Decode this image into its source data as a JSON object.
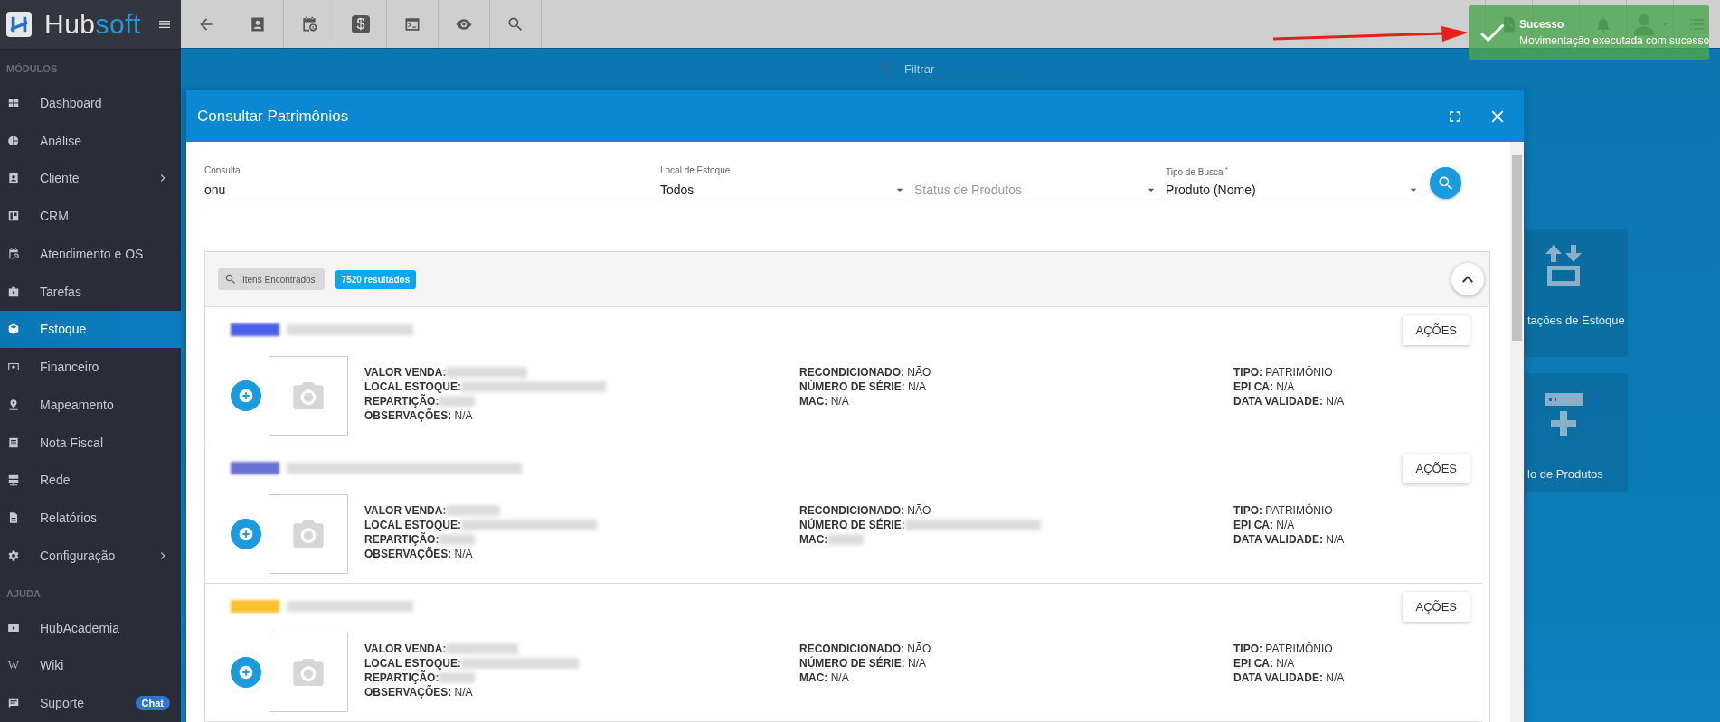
{
  "logo": {
    "part1": "Hub",
    "part2": "soft"
  },
  "sidebar": {
    "sections": [
      {
        "title": "MÓDULOS",
        "items": [
          {
            "label": "Dashboard",
            "selected": false,
            "submenu": false
          },
          {
            "label": "Análise",
            "selected": false,
            "submenu": false
          },
          {
            "label": "Cliente",
            "selected": false,
            "submenu": true
          },
          {
            "label": "CRM",
            "selected": false,
            "submenu": false
          },
          {
            "label": "Atendimento e OS",
            "selected": false,
            "submenu": false
          },
          {
            "label": "Tarefas",
            "selected": false,
            "submenu": false
          },
          {
            "label": "Estoque",
            "selected": true,
            "submenu": false
          },
          {
            "label": "Financeiro",
            "selected": false,
            "submenu": false
          },
          {
            "label": "Mapeamento",
            "selected": false,
            "submenu": false
          },
          {
            "label": "Nota Fiscal",
            "selected": false,
            "submenu": false
          },
          {
            "label": "Rede",
            "selected": false,
            "submenu": false
          },
          {
            "label": "Relatórios",
            "selected": false,
            "submenu": false
          },
          {
            "label": "Configuração",
            "selected": false,
            "submenu": true
          }
        ]
      },
      {
        "title": "AJUDA",
        "items": [
          {
            "label": "HubAcademia",
            "selected": false,
            "submenu": false
          },
          {
            "label": "Wiki",
            "selected": false,
            "submenu": false,
            "glyph": "W"
          },
          {
            "label": "Suporte",
            "selected": false,
            "submenu": false,
            "badge": "Chat"
          }
        ]
      }
    ]
  },
  "toolbar": {
    "buttons": [
      {
        "kind": "back"
      },
      {
        "kind": "contact"
      },
      {
        "kind": "calendar"
      },
      {
        "kind": "money",
        "glyph": "$"
      },
      {
        "kind": "terminal"
      },
      {
        "kind": "view"
      },
      {
        "kind": "search"
      }
    ]
  },
  "top_right": {
    "buttons": [
      {
        "kind": "pdf"
      },
      {
        "kind": "check"
      },
      {
        "kind": "bell"
      },
      {
        "kind": "avatar"
      },
      {
        "kind": "menu"
      }
    ]
  },
  "toast": {
    "title": "Sucesso",
    "message": "Movimentação executada com sucesso"
  },
  "filter": {
    "placeholder": "Filtrar"
  },
  "background_cards": [
    {
      "kind": "movement",
      "label": "tações de Estoque"
    },
    {
      "kind": "catalog",
      "label": "lo de Produtos"
    }
  ],
  "dialog": {
    "title": "Consultar Patrimônios",
    "form": {
      "fields": [
        {
          "kind": "text",
          "label": "Consulta",
          "value": "onu"
        },
        {
          "kind": "select",
          "label": "Local de Estoque",
          "value": "Todos"
        },
        {
          "kind": "select",
          "placeholder": "Status de Produtos"
        },
        {
          "kind": "select",
          "label": "Tipo de Busca",
          "required_mark": "*",
          "value": "Produto (Nome)"
        }
      ]
    },
    "results": {
      "chip": "Itens Encontrados",
      "count": "7520 resultados",
      "expanded": true,
      "items": [
        {
          "color": "#4c5fe6",
          "action": "AÇÕES",
          "columns": [
            [
              {
                "label": "VALOR VENDA:",
                "kind": "blurred"
              },
              {
                "label": "LOCAL ESTOQUE:",
                "kind": "blurred"
              },
              {
                "label": "REPARTIÇÃO:",
                "kind": "blurred"
              },
              {
                "label": "OBSERVAÇÕES:",
                "kind": "text",
                "value": "N/A"
              }
            ],
            [
              {
                "label": "RECONDICIONADO:",
                "kind": "text",
                "value": "NÃO"
              },
              {
                "label": "NÚMERO DE SÉRIE:",
                "kind": "text",
                "value": "N/A"
              },
              {
                "label": "MAC:",
                "kind": "text",
                "value": "N/A"
              }
            ],
            [
              {
                "label": "TIPO:",
                "kind": "text",
                "value": "PATRIMÔNIO"
              },
              {
                "label": "EPI CA:",
                "kind": "text",
                "value": "N/A"
              },
              {
                "label": "DATA VALIDADE:",
                "kind": "text",
                "value": "N/A"
              }
            ]
          ]
        },
        {
          "color": "#6a72d4",
          "action": "AÇÕES",
          "columns": [
            [
              {
                "label": "VALOR VENDA:",
                "kind": "blurred"
              },
              {
                "label": "LOCAL ESTOQUE:",
                "kind": "blurred"
              },
              {
                "label": "REPARTIÇÃO:",
                "kind": "blurred"
              },
              {
                "label": "OBSERVAÇÕES:",
                "kind": "text",
                "value": "N/A"
              }
            ],
            [
              {
                "label": "RECONDICIONADO:",
                "kind": "text",
                "value": "NÃO"
              },
              {
                "label": "NÚMERO DE SÉRIE:",
                "kind": "blurred"
              },
              {
                "label": "MAC:",
                "kind": "blurred"
              }
            ],
            [
              {
                "label": "TIPO:",
                "kind": "text",
                "value": "PATRIMÔNIO"
              },
              {
                "label": "EPI CA:",
                "kind": "text",
                "value": "N/A"
              },
              {
                "label": "DATA VALIDADE:",
                "kind": "text",
                "value": "N/A"
              }
            ]
          ]
        },
        {
          "color": "#fbc02d",
          "action": "AÇÕES",
          "columns": [
            [
              {
                "label": "VALOR VENDA:",
                "kind": "blurred"
              },
              {
                "label": "LOCAL ESTOQUE:",
                "kind": "blurred"
              },
              {
                "label": "REPARTIÇÃO:",
                "kind": "blurred"
              },
              {
                "label": "OBSERVAÇÕES:",
                "kind": "text",
                "value": "N/A"
              }
            ],
            [
              {
                "label": "RECONDICIONADO:",
                "kind": "text",
                "value": "NÃO"
              },
              {
                "label": "NÚMERO DE SÉRIE:",
                "kind": "text",
                "value": "N/A"
              },
              {
                "label": "MAC:",
                "kind": "text",
                "value": "N/A"
              }
            ],
            [
              {
                "label": "TIPO:",
                "kind": "text",
                "value": "PATRIMÔNIO"
              },
              {
                "label": "EPI CA:",
                "kind": "text",
                "value": "N/A"
              },
              {
                "label": "DATA VALIDADE:",
                "kind": "text",
                "value": "N/A"
              }
            ]
          ]
        }
      ]
    }
  }
}
